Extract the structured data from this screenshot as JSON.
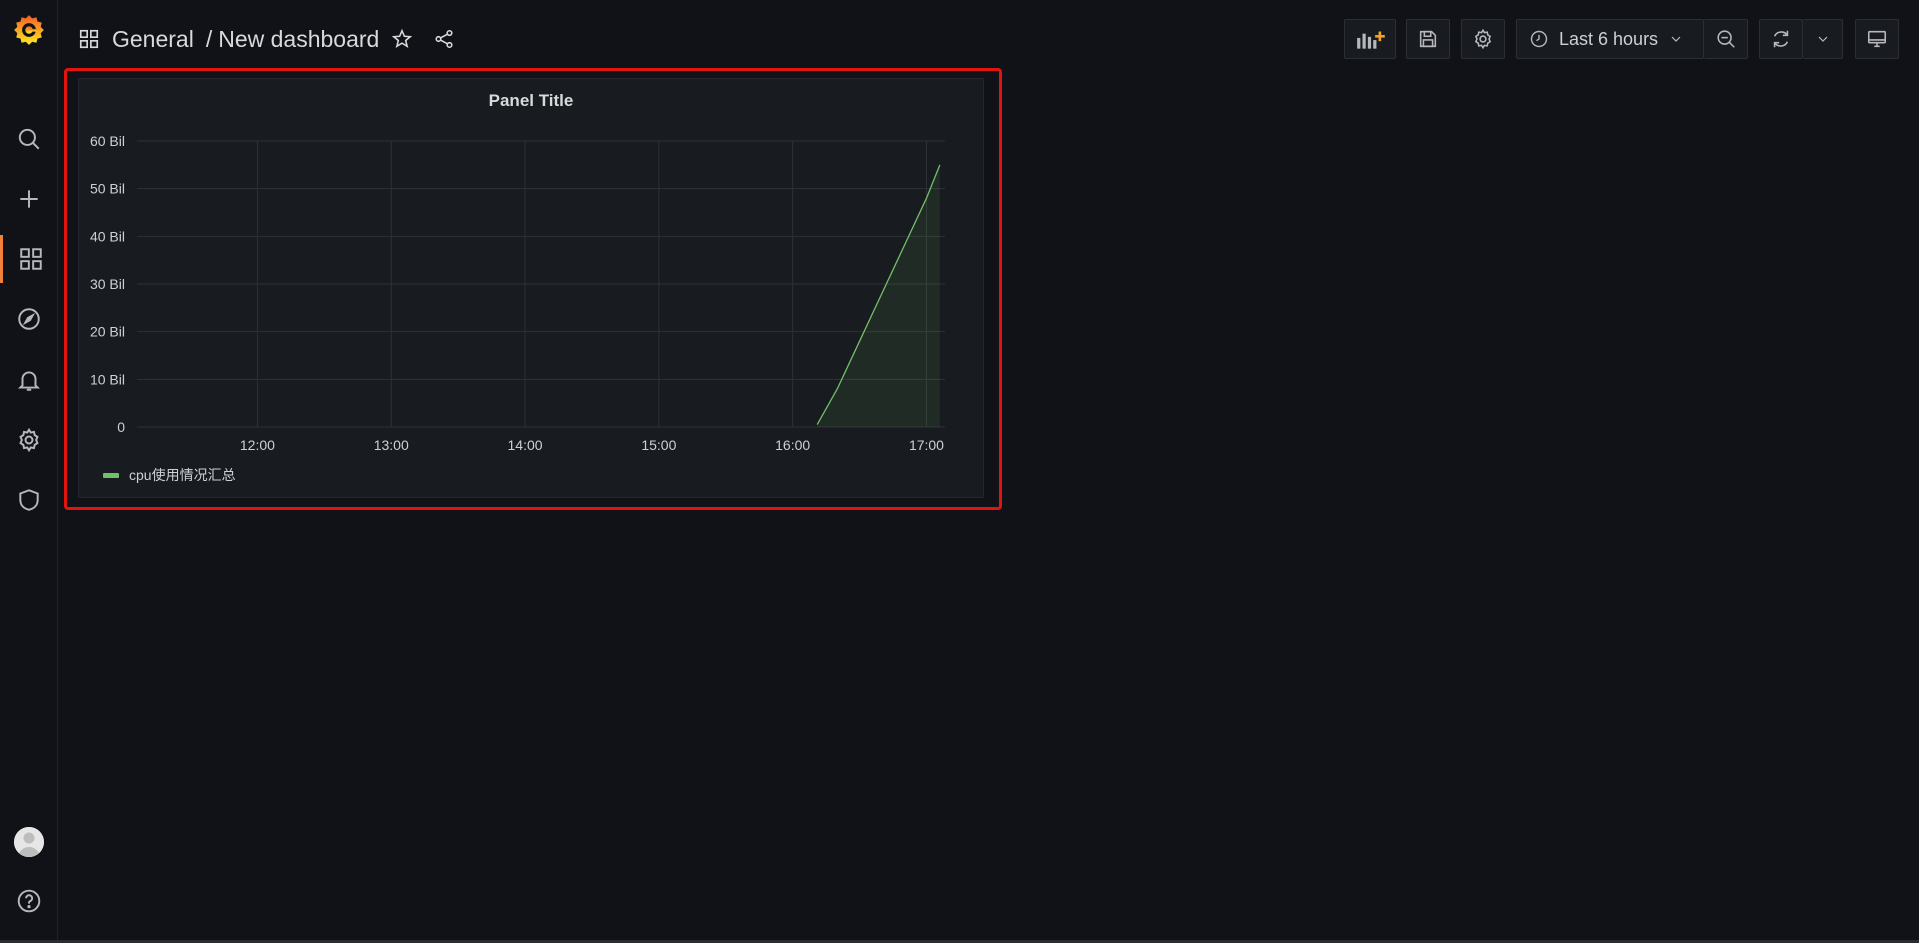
{
  "breadcrumb": {
    "folder": "General",
    "separator": "/",
    "dashboard": "New dashboard"
  },
  "toolbar": {
    "time_range": "Last 6 hours"
  },
  "panel": {
    "title": "Panel Title",
    "legend": "cpu使用情况汇总"
  },
  "chart_data": {
    "type": "area",
    "title": "Panel Title",
    "yunit": "Bil",
    "y_ticks": [
      "0",
      "10 Bil",
      "20 Bil",
      "30 Bil",
      "40 Bil",
      "50 Bil",
      "60 Bil"
    ],
    "ylim": [
      0,
      60
    ],
    "x_ticks": [
      "12:00",
      "13:00",
      "14:00",
      "15:00",
      "16:00",
      "17:00"
    ],
    "xlim": [
      "11:06",
      "17:11"
    ],
    "grid": true,
    "legend_position": "bottom-left",
    "series": [
      {
        "name": "cpu使用情况汇总",
        "color": "#73bf69",
        "points": [
          {
            "x": "16:11",
            "y": 0.5
          },
          {
            "x": "16:20",
            "y": 8
          },
          {
            "x": "16:30",
            "y": 18
          },
          {
            "x": "16:40",
            "y": 28
          },
          {
            "x": "16:50",
            "y": 38
          },
          {
            "x": "17:00",
            "y": 48
          },
          {
            "x": "17:06",
            "y": 55
          }
        ]
      }
    ]
  },
  "colors": {
    "accent": "#f0803c",
    "series": "#73bf69",
    "highlight": "#e3140e",
    "bg": "#111217"
  }
}
